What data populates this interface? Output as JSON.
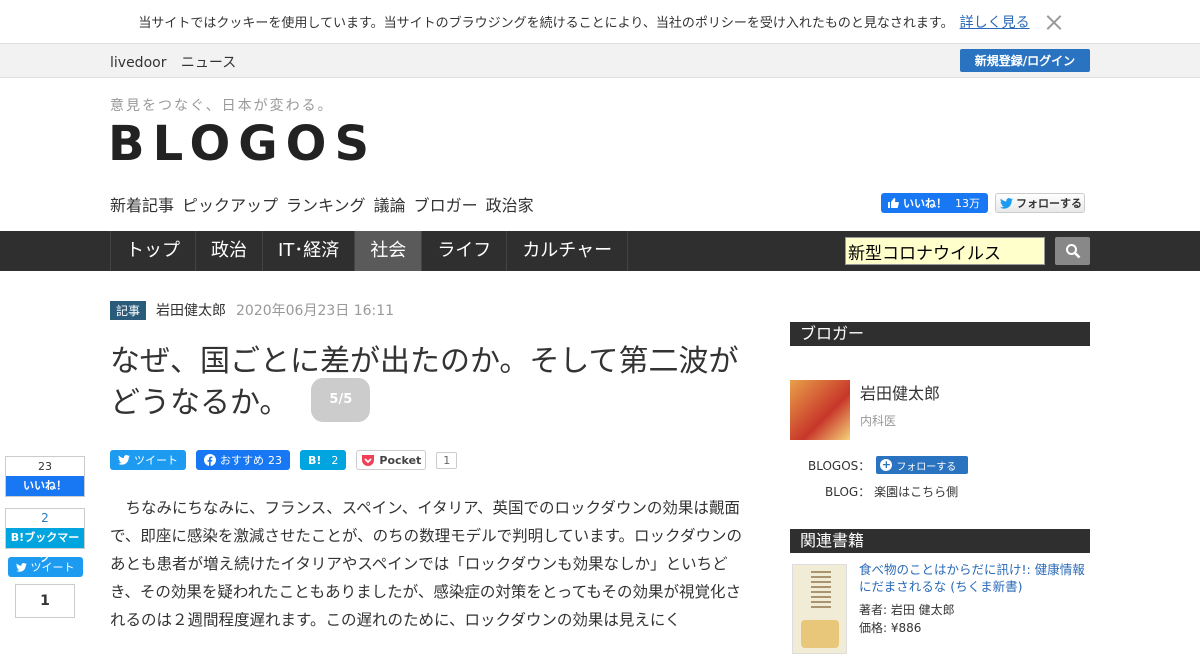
{
  "cookie": {
    "message": "当サイトではクッキーを使用しています。当サイトのブラウジングを続けることにより、当社のポリシーを受け入れたものと見なされます。",
    "more_link": "詳しく見る"
  },
  "livedoor": {
    "brand": "livedoor",
    "news": "ニュース",
    "login_button": "新規登録/ログイン"
  },
  "header": {
    "tagline": "意見をつなぐ、日本が変わる。",
    "logo": "BLOGOS",
    "subnav": [
      "新着記事",
      "ピックアップ",
      "ランキング",
      "議論",
      "ブロガー",
      "政治家"
    ],
    "fb_like_label": "いいね！",
    "fb_like_count": "13万",
    "twitter_follow": "フォローする"
  },
  "mainnav": {
    "items": [
      "トップ",
      "政治",
      "IT･経済",
      "社会",
      "ライフ",
      "カルチャー"
    ],
    "active_index": 3,
    "search_value": "新型コロナウイルス"
  },
  "article": {
    "badge": "記事",
    "author": "岩田健太郎",
    "date": "2020年06月23日 16:11",
    "title": "なぜ、国ごとに差が出たのか。そして第二波がどうなるか。",
    "page": "5/5",
    "share": {
      "tweet": "ツイート",
      "fb_label": "おすすめ",
      "fb_count": "23",
      "hatena_label": "B!",
      "hatena_count": "2",
      "pocket_label": "Pocket",
      "pocket_count": "1"
    },
    "body": "ちなみにちなみに、フランス、スペイン、イタリア、英国でのロックダウンの効果は覿面で、即座に感染を激減させたことが、のちの数理モデルで判明しています。ロックダウンのあとも患者が増え続けたイタリアやスペインでは「ロックダウンも効果なしか」といちどき、その効果を疑われたこともありましたが、感染症の対策をとってもその効果が視覚化されるのは２週間程度遅れます。この遅れのために、ロックダウンの効果は見えにく"
  },
  "side_share": {
    "fb_count": "23",
    "fb_label": "いいね！",
    "hatena_count": "2",
    "hatena_label": "B!ブックマーク",
    "tweet": "ツイート",
    "pocket_count": "1"
  },
  "sidebar": {
    "blogger_heading": "ブロガー",
    "blogger_name": "岩田健太郎",
    "blogger_role": "内科医",
    "blogos_label": "BLOGOS：",
    "follow_button": "フォローする",
    "blog_label": "BLOG：",
    "blog_name": "楽園はこちら側",
    "books_heading": "関連書籍",
    "book": {
      "title": "食べ物のことはからだに訊け!: 健康情報にだまされるな (ちくま新書)",
      "author": "著者: 岩田 健太郎",
      "price": "価格: ¥886"
    }
  },
  "colors": {
    "nav_bg": "#2f2f2f",
    "accent_blue": "#2a73c0",
    "search_bg": "#ffffcc"
  }
}
